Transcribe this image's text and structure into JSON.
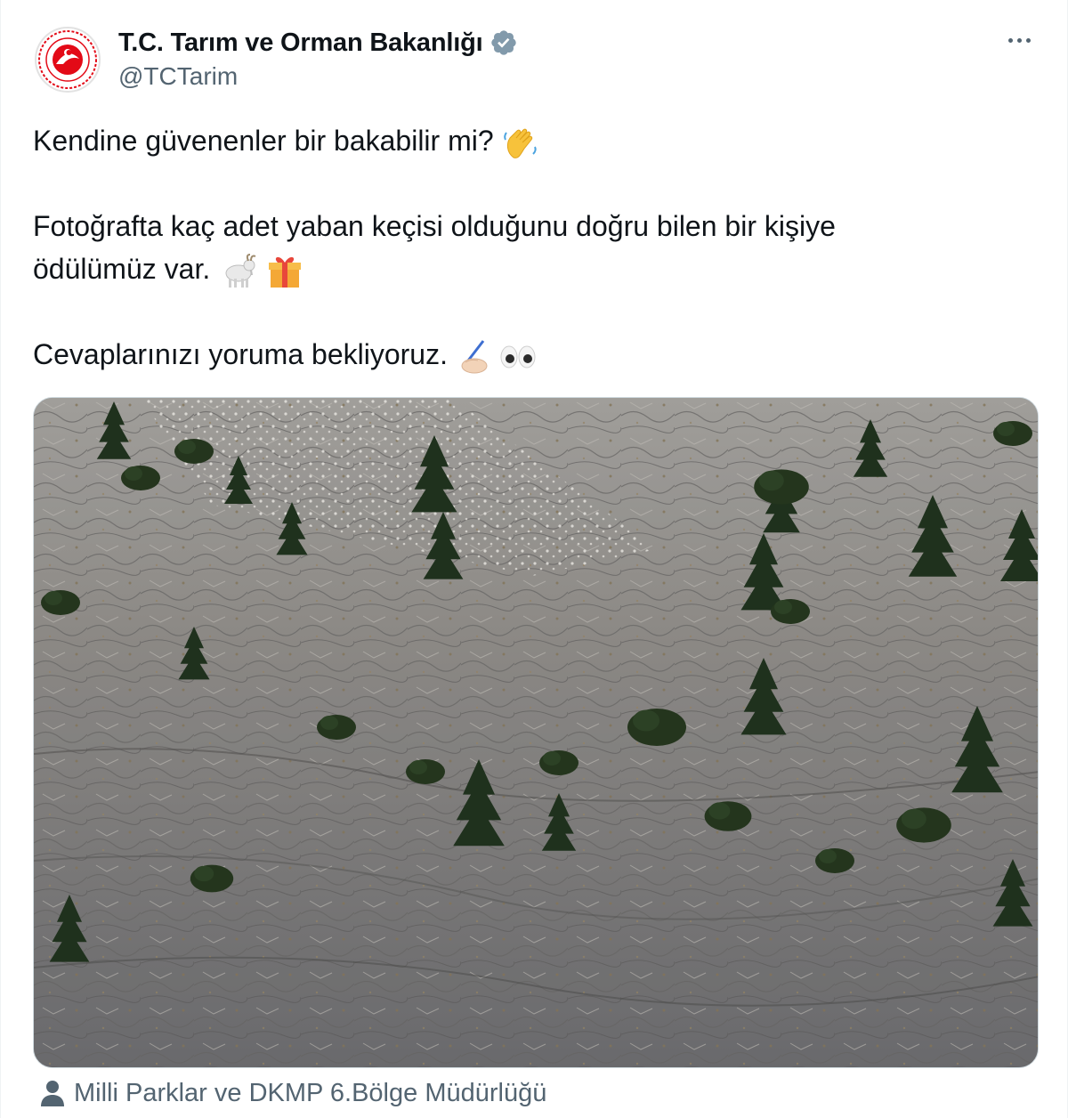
{
  "author": {
    "display_name": "T.C. Tarım ve Orman Bakanlığı",
    "handle": "@TCTarim",
    "verified": true,
    "avatar_icon": "ministry-logo-icon",
    "brand_color": "#e30a17"
  },
  "tweet": {
    "line1": "Kendine güvenenler bir bakabilir mi?",
    "line2": "Fotoğrafta kaç adet yaban keçisi olduğunu doğru bilen bir kişiye",
    "line3": "ödülümüz var.",
    "line4": "Cevaplarınızı yoruma bekliyoruz.",
    "emojis": [
      "waving-hand-icon",
      "goat-icon",
      "gift-icon",
      "writing-hand-icon",
      "eyes-icon"
    ]
  },
  "media": {
    "icon": "rocky-mountainside-photo",
    "tag_icon": "person-tag-icon",
    "tagged": "Milli Parklar ve DKMP 6.Bölge Müdürlüğü"
  },
  "menu": {
    "icon": "more-options-icon"
  },
  "colors": {
    "text": "#0f1419",
    "secondary": "#536471",
    "verified": "#829aab"
  }
}
